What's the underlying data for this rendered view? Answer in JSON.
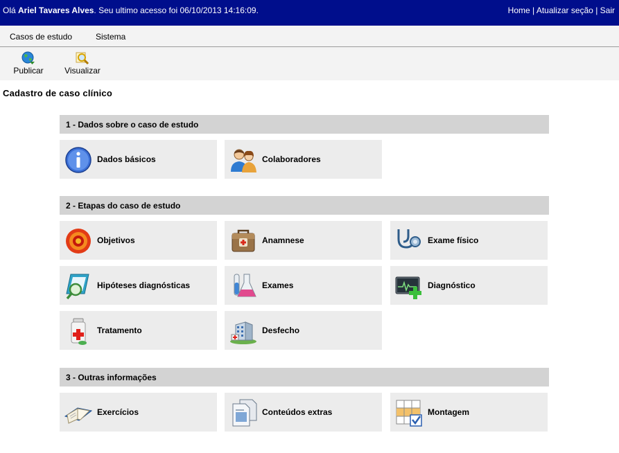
{
  "topbar": {
    "greeting_prefix": "Olá ",
    "user_name": "Ariel Tavares Alves",
    "greeting_suffix": ". Seu ultimo acesso foi 06/10/2013 14:16:09.",
    "links": [
      "Home",
      "Atualizar seção",
      "Sair"
    ],
    "separator": " | "
  },
  "menu": {
    "items": [
      "Casos de estudo",
      "Sistema"
    ]
  },
  "toolbar": {
    "publish_label": "Publicar",
    "view_label": "Visualizar"
  },
  "page": {
    "title": "Cadastro de caso clínico"
  },
  "sections": [
    {
      "title": "1 - Dados sobre o caso de estudo",
      "tiles": [
        {
          "label": "Dados básicos",
          "icon": "info-icon"
        },
        {
          "label": "Colaboradores",
          "icon": "collaborators-icon"
        }
      ]
    },
    {
      "title": "2 - Etapas do caso de estudo",
      "tiles": [
        {
          "label": "Objetivos",
          "icon": "target-icon"
        },
        {
          "label": "Anamnese",
          "icon": "medical-bag-icon"
        },
        {
          "label": "Exame físico",
          "icon": "stethoscope-icon"
        },
        {
          "label": "Hipóteses diagnósticas",
          "icon": "magnifier-document-icon"
        },
        {
          "label": "Exames",
          "icon": "lab-flasks-icon"
        },
        {
          "label": "Diagnóstico",
          "icon": "monitor-plus-icon"
        },
        {
          "label": "Tratamento",
          "icon": "medicine-bottle-icon"
        },
        {
          "label": "Desfecho",
          "icon": "hospital-icon"
        }
      ]
    },
    {
      "title": "3 - Outras informações",
      "tiles": [
        {
          "label": "Exercícios",
          "icon": "open-book-icon"
        },
        {
          "label": "Conteúdos extras",
          "icon": "documents-icon"
        },
        {
          "label": "Montagem",
          "icon": "grid-check-icon"
        }
      ]
    }
  ],
  "colors": {
    "topbar": "#000e8c",
    "section_header": "#d3d3d3",
    "tile": "#ececec"
  }
}
